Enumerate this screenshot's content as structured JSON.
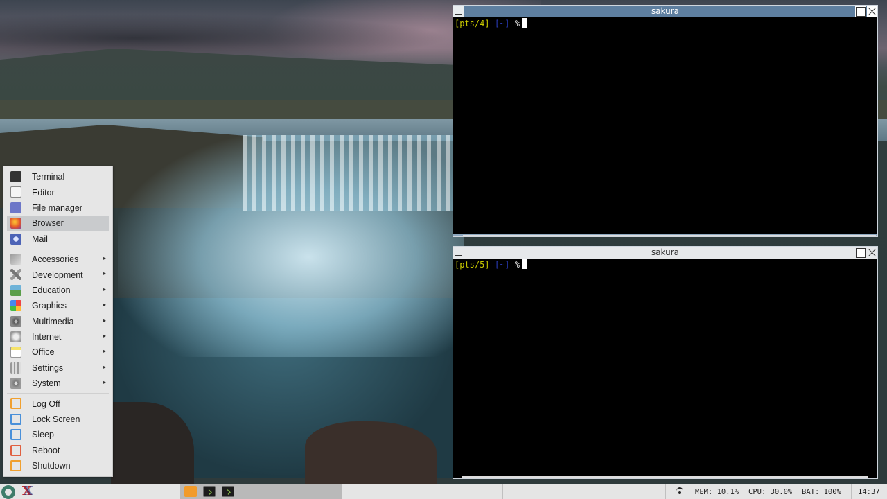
{
  "terminals": [
    {
      "title": "sakura",
      "prompt_tty": "pts/4",
      "prompt_dir": "~",
      "prompt_symbol": "%"
    },
    {
      "title": "sakura",
      "prompt_tty": "pts/5",
      "prompt_dir": "~",
      "prompt_symbol": "%"
    }
  ],
  "start_menu": {
    "favorites": [
      {
        "label": "Terminal",
        "icon": "terminal-icon"
      },
      {
        "label": "Editor",
        "icon": "editor-icon"
      },
      {
        "label": "File manager",
        "icon": "file-manager-icon"
      },
      {
        "label": "Browser",
        "icon": "firefox-icon"
      },
      {
        "label": "Mail",
        "icon": "thunderbird-icon"
      }
    ],
    "categories": [
      {
        "label": "Accessories",
        "icon": "accessories-icon"
      },
      {
        "label": "Development",
        "icon": "development-icon"
      },
      {
        "label": "Education",
        "icon": "education-icon"
      },
      {
        "label": "Graphics",
        "icon": "graphics-icon"
      },
      {
        "label": "Multimedia",
        "icon": "multimedia-icon"
      },
      {
        "label": "Internet",
        "icon": "internet-icon"
      },
      {
        "label": "Office",
        "icon": "office-icon"
      },
      {
        "label": "Settings",
        "icon": "settings-icon"
      },
      {
        "label": "System",
        "icon": "system-icon"
      }
    ],
    "session": [
      {
        "label": "Log Off",
        "icon": "log-off-icon"
      },
      {
        "label": "Lock Screen",
        "icon": "lock-screen-icon"
      },
      {
        "label": "Sleep",
        "icon": "sleep-icon"
      },
      {
        "label": "Reboot",
        "icon": "reboot-icon"
      },
      {
        "label": "Shutdown",
        "icon": "shutdown-icon"
      }
    ],
    "submenu_arrow": "▸",
    "highlighted": "Browser"
  },
  "taskbar": {
    "mem": "MEM: 10.1%",
    "cpu": "CPU: 30.0%",
    "bat": "BAT: 100%",
    "clock": "14:37"
  },
  "colors": {
    "active_titlebar": "#5e7fa0",
    "prompt_tty": "#c8c800",
    "prompt_dir": "#2a3cb8",
    "menu_highlight": "#c9cbcd"
  }
}
